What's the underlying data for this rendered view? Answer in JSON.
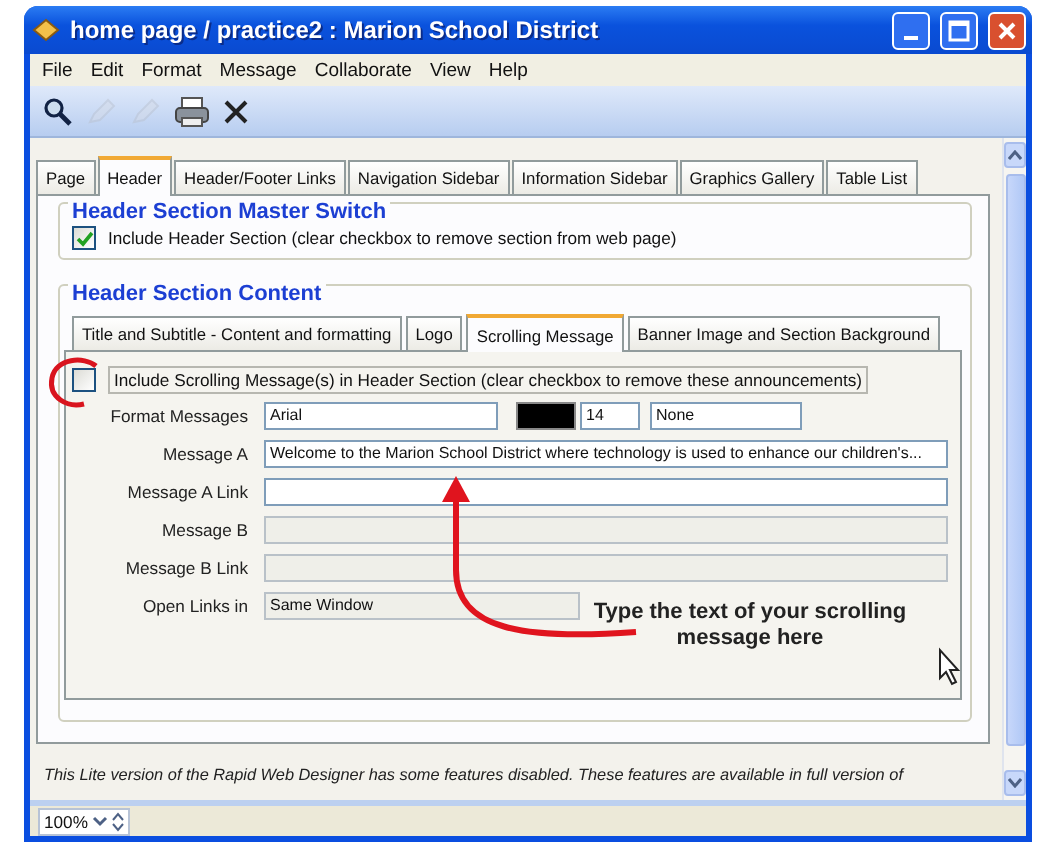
{
  "window": {
    "title": "home page / practice2 : Marion School District"
  },
  "menu": [
    "File",
    "Edit",
    "Format",
    "Message",
    "Collaborate",
    "View",
    "Help"
  ],
  "toolbar": [
    {
      "kind": "search",
      "disabled": false
    },
    {
      "kind": "pencil",
      "disabled": true
    },
    {
      "kind": "pencil",
      "disabled": true
    },
    {
      "kind": "printer",
      "disabled": false
    },
    {
      "kind": "close",
      "disabled": false
    }
  ],
  "tabs": [
    {
      "label": "Page",
      "selected": false
    },
    {
      "label": "Header",
      "selected": true
    },
    {
      "label": "Header/Footer Links",
      "selected": false
    },
    {
      "label": "Navigation Sidebar",
      "selected": false
    },
    {
      "label": "Information Sidebar",
      "selected": false
    },
    {
      "label": "Graphics Gallery",
      "selected": false
    },
    {
      "label": "Table List",
      "selected": false
    }
  ],
  "master_switch": {
    "title": "Header Section Master Switch",
    "checkbox": {
      "label": "Include Header Section (clear checkbox to remove section from web page)",
      "checked": true
    }
  },
  "content": {
    "title": "Header Section Content",
    "subtabs": [
      {
        "label": "Title and Subtitle - Content and formatting",
        "selected": false
      },
      {
        "label": "Logo",
        "selected": false
      },
      {
        "label": "Scrolling Message",
        "selected": true
      },
      {
        "label": "Banner Image and Section Background",
        "selected": false
      }
    ],
    "checkbox": {
      "label": "Include Scrolling Message(s) in Header Section (clear checkbox to remove these announcements)",
      "checked": false
    },
    "format": {
      "label": "Format Messages",
      "font": "Arial",
      "color": "#000000",
      "size": "14",
      "style": "None"
    },
    "fields": [
      {
        "label": "Message A",
        "value": "Welcome to the Marion School District where technology is used to enhance our children's...",
        "kind": "text",
        "disabled": false
      },
      {
        "label": "Message A Link",
        "kind": "text",
        "disabled": false
      },
      {
        "label": "Message B",
        "kind": "text",
        "disabled": true
      },
      {
        "label": "Message B Link",
        "kind": "text",
        "disabled": true
      },
      {
        "label": "Open Links in",
        "value": "Same Window",
        "kind": "select",
        "disabled": true
      }
    ]
  },
  "annotation": "Type the text of your scrolling message here",
  "notice": "This Lite version of the Rapid Web Designer has some features disabled.  These features are available in full version of",
  "status_bar": {
    "zoom": "100%"
  }
}
